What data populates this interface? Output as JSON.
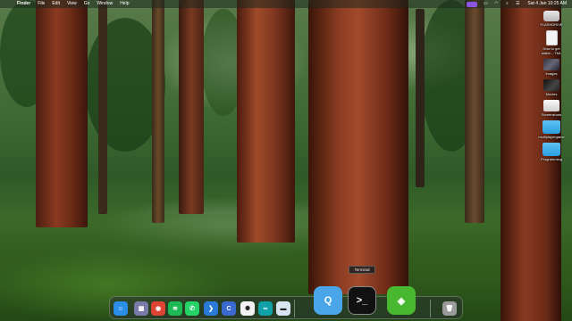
{
  "menubar": {
    "app_name": "Finder",
    "items": [
      "File",
      "Edit",
      "View",
      "Go",
      "Window",
      "Help"
    ],
    "status_icons": [
      "vpn-icon",
      "battery-icon",
      "wifi-icon",
      "search-icon",
      "control-center-icon"
    ],
    "clock": "Sat 4 Jan  10:25 AM"
  },
  "desktop": {
    "items": [
      {
        "label": "FLASHDRIVE",
        "kind": "drive"
      },
      {
        "label": "How to get starte....TML",
        "kind": "doc"
      },
      {
        "label": "Images",
        "kind": "img"
      },
      {
        "label": "Movies",
        "kind": "mov"
      },
      {
        "label": "Screenshots",
        "kind": "shot"
      },
      {
        "label": "multiplayergame",
        "kind": "folder"
      },
      {
        "label": "Programming",
        "kind": "folder"
      }
    ]
  },
  "dock": {
    "tooltip": "Terminal",
    "apps": [
      {
        "name": "finder-icon",
        "glyph": "☺",
        "color": "#2a8de8"
      },
      {
        "name": "launchpad-icon",
        "glyph": "▦",
        "color": "#7a7aa8"
      },
      {
        "name": "chrome-icon",
        "glyph": "◉",
        "color": "#dd4433"
      },
      {
        "name": "spotify-icon",
        "glyph": "≋",
        "color": "#1db954"
      },
      {
        "name": "whatsapp-icon",
        "glyph": "✆",
        "color": "#25d366"
      },
      {
        "name": "vscode-icon",
        "glyph": "❯",
        "color": "#2a7bd8"
      },
      {
        "name": "codeapp-icon",
        "glyph": "C",
        "color": "#3a6ad0"
      },
      {
        "name": "chatgpt-icon",
        "glyph": "✺",
        "color": "#f2f2f2"
      },
      {
        "name": "arduino-icon",
        "glyph": "∞",
        "color": "#10a0a8"
      },
      {
        "name": "app-icon",
        "glyph": "▬",
        "color": "#d8e4f0"
      },
      {
        "name": "quicktime-icon",
        "glyph": "Q",
        "color": "#4aa6e8"
      },
      {
        "name": "terminal-icon",
        "glyph": ">_",
        "color": "#111111"
      },
      {
        "name": "cube-app-icon",
        "glyph": "◈",
        "color": "#48b830"
      },
      {
        "name": "trash-icon",
        "glyph": "🗑",
        "color": "#9a9a9a"
      }
    ]
  }
}
